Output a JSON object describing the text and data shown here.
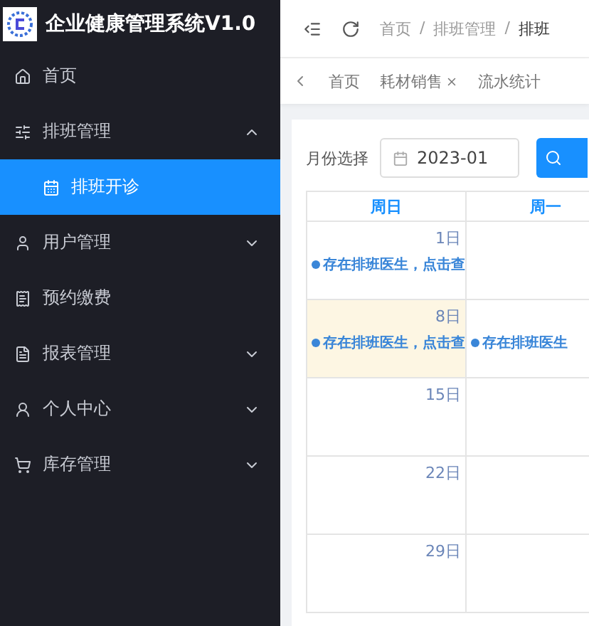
{
  "sidebar": {
    "title": "企业健康管理系统V1.0",
    "items": [
      {
        "kind": "item",
        "label": "首页",
        "selected": false
      },
      {
        "kind": "group",
        "label": "排班管理",
        "expanded": true,
        "children": [
          {
            "label": "排班开诊",
            "selected": true
          }
        ]
      },
      {
        "kind": "group",
        "label": "用户管理",
        "expanded": false
      },
      {
        "kind": "item",
        "label": "预约缴费",
        "selected": false
      },
      {
        "kind": "group",
        "label": "报表管理",
        "expanded": false
      },
      {
        "kind": "group",
        "label": "个人中心",
        "expanded": false
      },
      {
        "kind": "group",
        "label": "库存管理",
        "expanded": false
      }
    ]
  },
  "breadcrumb": [
    {
      "kind": "link",
      "text": "首页"
    },
    {
      "kind": "separator",
      "text": "/"
    },
    {
      "kind": "link",
      "text": "排班管理"
    },
    {
      "kind": "separator",
      "text": "/"
    },
    {
      "kind": "current",
      "text": "排班"
    }
  ],
  "tabs": [
    {
      "label": "首页",
      "closable": false,
      "selected": false
    },
    {
      "label": "耗材销售",
      "closable": true,
      "selected": false
    },
    {
      "label": "流水统计",
      "closable": false,
      "selected": false
    }
  ],
  "filter": {
    "label": "月份选择",
    "value": "2023-01"
  },
  "calendar": {
    "weekdays": [
      "周日",
      "周一"
    ],
    "rows": [
      [
        {
          "day": "1日",
          "highlighted": false,
          "events": [
            "存在排班医生，点击查"
          ]
        },
        {
          "highlighted": false
        }
      ],
      [
        {
          "day": "8日",
          "highlighted": true,
          "events": [
            "存在排班医生，点击查"
          ]
        },
        {
          "highlighted": false,
          "events": [
            "存在排班医生"
          ]
        }
      ],
      [
        {
          "day": "15日",
          "highlighted": false
        },
        {
          "highlighted": false
        }
      ],
      [
        {
          "day": "22日",
          "highlighted": false
        },
        {
          "highlighted": false
        }
      ],
      [
        {
          "day": "29日",
          "highlighted": false
        },
        {
          "highlighted": false
        }
      ]
    ]
  }
}
